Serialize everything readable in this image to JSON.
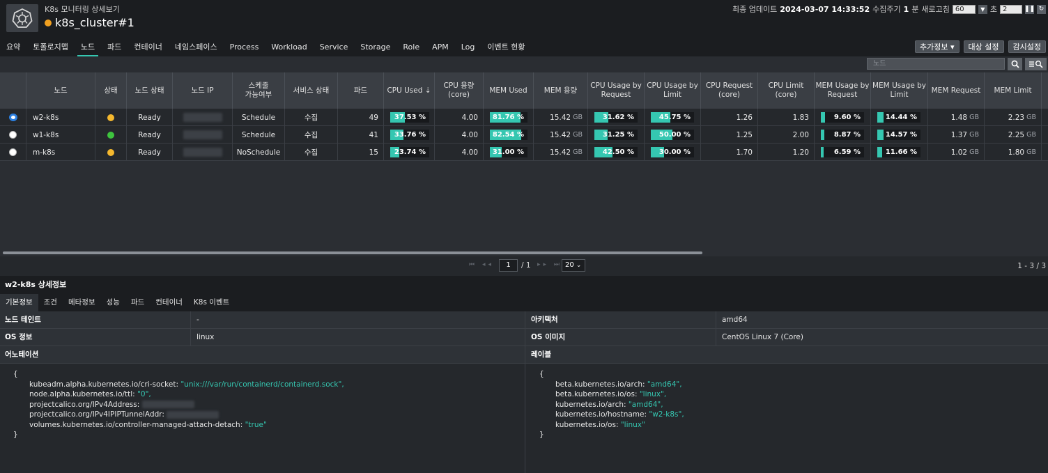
{
  "header": {
    "app_subtitle": "K8s 모니터링 상세보기",
    "cluster_name": "k8s_cluster#1",
    "status_color": "#f0a020",
    "last_update_label": "최종 업데이트",
    "last_update_value": "2024-03-07 14:33:52",
    "interval_label": "수집주기",
    "interval_value": "1",
    "interval_unit": "분",
    "refresh_label": "새로고침",
    "refresh_value": "60",
    "seconds_label": "초",
    "seconds_value": "2"
  },
  "nav": {
    "items": [
      "요약",
      "토폴로지맵",
      "노드",
      "파드",
      "컨테이너",
      "네임스페이스",
      "Process",
      "Workload",
      "Service",
      "Storage",
      "Role",
      "APM",
      "Log",
      "이벤트 현황"
    ],
    "active_index": 2,
    "buttons": [
      "추가정보 ▾",
      "대상 설정",
      "감시설정"
    ]
  },
  "toolbar": {
    "search_placeholder": "노드"
  },
  "table": {
    "headers": [
      "노드",
      "상태",
      "노드 상태",
      "노드 IP",
      "스케줄\n가능여부",
      "서비스 상태",
      "파드",
      "CPU Used ⇣",
      "CPU 용량\n(core)",
      "MEM Used",
      "MEM 용량",
      "CPU Usage by\nRequest",
      "CPU Usage by\nLimit",
      "CPU Request\n(core)",
      "CPU Limit\n(core)",
      "MEM Usage by\nRequest",
      "MEM Usage by\nLimit",
      "MEM Request",
      "MEM Limit"
    ],
    "rows": [
      {
        "selected": true,
        "name": "w2-k8s",
        "status_color": "#f5b82e",
        "node_status": "Ready",
        "schedulable": "Schedule",
        "service_status": "수집",
        "pods": "49",
        "cpu_used": "37.53 %",
        "cpu_used_pct": 37.53,
        "cpu_cap": "4.00",
        "mem_used": "81.76 %",
        "mem_used_pct": 81.76,
        "mem_cap": "15.42",
        "mem_cap_unit": "GB",
        "cpu_req_usage": "31.62 %",
        "cpu_req_usage_pct": 31.62,
        "cpu_lim_usage": "45.75 %",
        "cpu_lim_usage_pct": 45.75,
        "cpu_req": "1.26",
        "cpu_lim": "1.83",
        "mem_req_usage": "9.60 %",
        "mem_req_usage_pct": 9.6,
        "mem_lim_usage": "14.44 %",
        "mem_lim_usage_pct": 14.44,
        "mem_req": "1.48",
        "mem_req_unit": "GB",
        "mem_lim": "2.23",
        "mem_lim_unit": "GB"
      },
      {
        "selected": false,
        "name": "w1-k8s",
        "status_color": "#3ec43e",
        "node_status": "Ready",
        "schedulable": "Schedule",
        "service_status": "수집",
        "pods": "41",
        "cpu_used": "33.76 %",
        "cpu_used_pct": 33.76,
        "cpu_cap": "4.00",
        "mem_used": "82.54 %",
        "mem_used_pct": 82.54,
        "mem_cap": "15.42",
        "mem_cap_unit": "GB",
        "cpu_req_usage": "31.25 %",
        "cpu_req_usage_pct": 31.25,
        "cpu_lim_usage": "50.00 %",
        "cpu_lim_usage_pct": 50.0,
        "cpu_req": "1.25",
        "cpu_lim": "2.00",
        "mem_req_usage": "8.87 %",
        "mem_req_usage_pct": 8.87,
        "mem_lim_usage": "14.57 %",
        "mem_lim_usage_pct": 14.57,
        "mem_req": "1.37",
        "mem_req_unit": "GB",
        "mem_lim": "2.25",
        "mem_lim_unit": "GB"
      },
      {
        "selected": false,
        "name": "m-k8s",
        "status_color": "#f5b82e",
        "node_status": "Ready",
        "schedulable": "NoSchedule",
        "service_status": "수집",
        "pods": "15",
        "cpu_used": "23.74 %",
        "cpu_used_pct": 23.74,
        "cpu_cap": "4.00",
        "mem_used": "31.00 %",
        "mem_used_pct": 31.0,
        "mem_cap": "15.42",
        "mem_cap_unit": "GB",
        "cpu_req_usage": "42.50 %",
        "cpu_req_usage_pct": 42.5,
        "cpu_lim_usage": "30.00 %",
        "cpu_lim_usage_pct": 30.0,
        "cpu_req": "1.70",
        "cpu_lim": "1.20",
        "mem_req_usage": "6.59 %",
        "mem_req_usage_pct": 6.59,
        "mem_lim_usage": "11.66 %",
        "mem_lim_usage_pct": 11.66,
        "mem_req": "1.02",
        "mem_req_unit": "GB",
        "mem_lim": "1.80",
        "mem_lim_unit": "GB"
      }
    ]
  },
  "pager": {
    "page": "1",
    "total": "/ 1",
    "page_size": "20",
    "range": "1 - 3 / 3"
  },
  "detail": {
    "title": "w2-k8s 상세정보",
    "tabs": [
      "기본정보",
      "조건",
      "메타정보",
      "성능",
      "파드",
      "컨테이너",
      "K8s 이벤트"
    ],
    "active_tab": 0,
    "taint_label": "노드 테인트",
    "taint_value": "-",
    "arch_label": "아키텍처",
    "arch_value": "amd64",
    "os_label": "OS 정보",
    "os_value": "linux",
    "os_image_label": "OS 이미지",
    "os_image_value": "CentOS Linux 7 (Core)",
    "annotation_label": "어노테이션",
    "label_label": "레이블",
    "open_brace": "{",
    "close_brace": "}",
    "annotations": [
      {
        "key": "kubeadm.alpha.kubernetes.io/cri-socket: ",
        "value": "\"unix:///var/run/containerd/containerd.sock\","
      },
      {
        "key": "node.alpha.kubernetes.io/ttl: ",
        "value": "\"0\","
      },
      {
        "key": "projectcalico.org/IPv4Address: ",
        "value": ""
      },
      {
        "key": "projectcalico.org/IPv4IPIPTunnelAddr: ",
        "value": ""
      },
      {
        "key": "volumes.kubernetes.io/controller-managed-attach-detach: ",
        "value": "\"true\""
      }
    ],
    "labels": [
      {
        "key": "beta.kubernetes.io/arch: ",
        "value": "\"amd64\","
      },
      {
        "key": "beta.kubernetes.io/os: ",
        "value": "\"linux\","
      },
      {
        "key": "kubernetes.io/arch: ",
        "value": "\"amd64\","
      },
      {
        "key": "kubernetes.io/hostname: ",
        "value": "\"w2-k8s\","
      },
      {
        "key": "kubernetes.io/os: ",
        "value": "\"linux\""
      }
    ]
  },
  "colors": {
    "accent": "#35c7b1",
    "selected_radio": "#2b7fe0"
  },
  "icons": [
    "kubernetes-logo-icon",
    "search-icon",
    "filter-icon",
    "pause-icon",
    "refresh-icon",
    "dropdown-arrow-icon"
  ]
}
